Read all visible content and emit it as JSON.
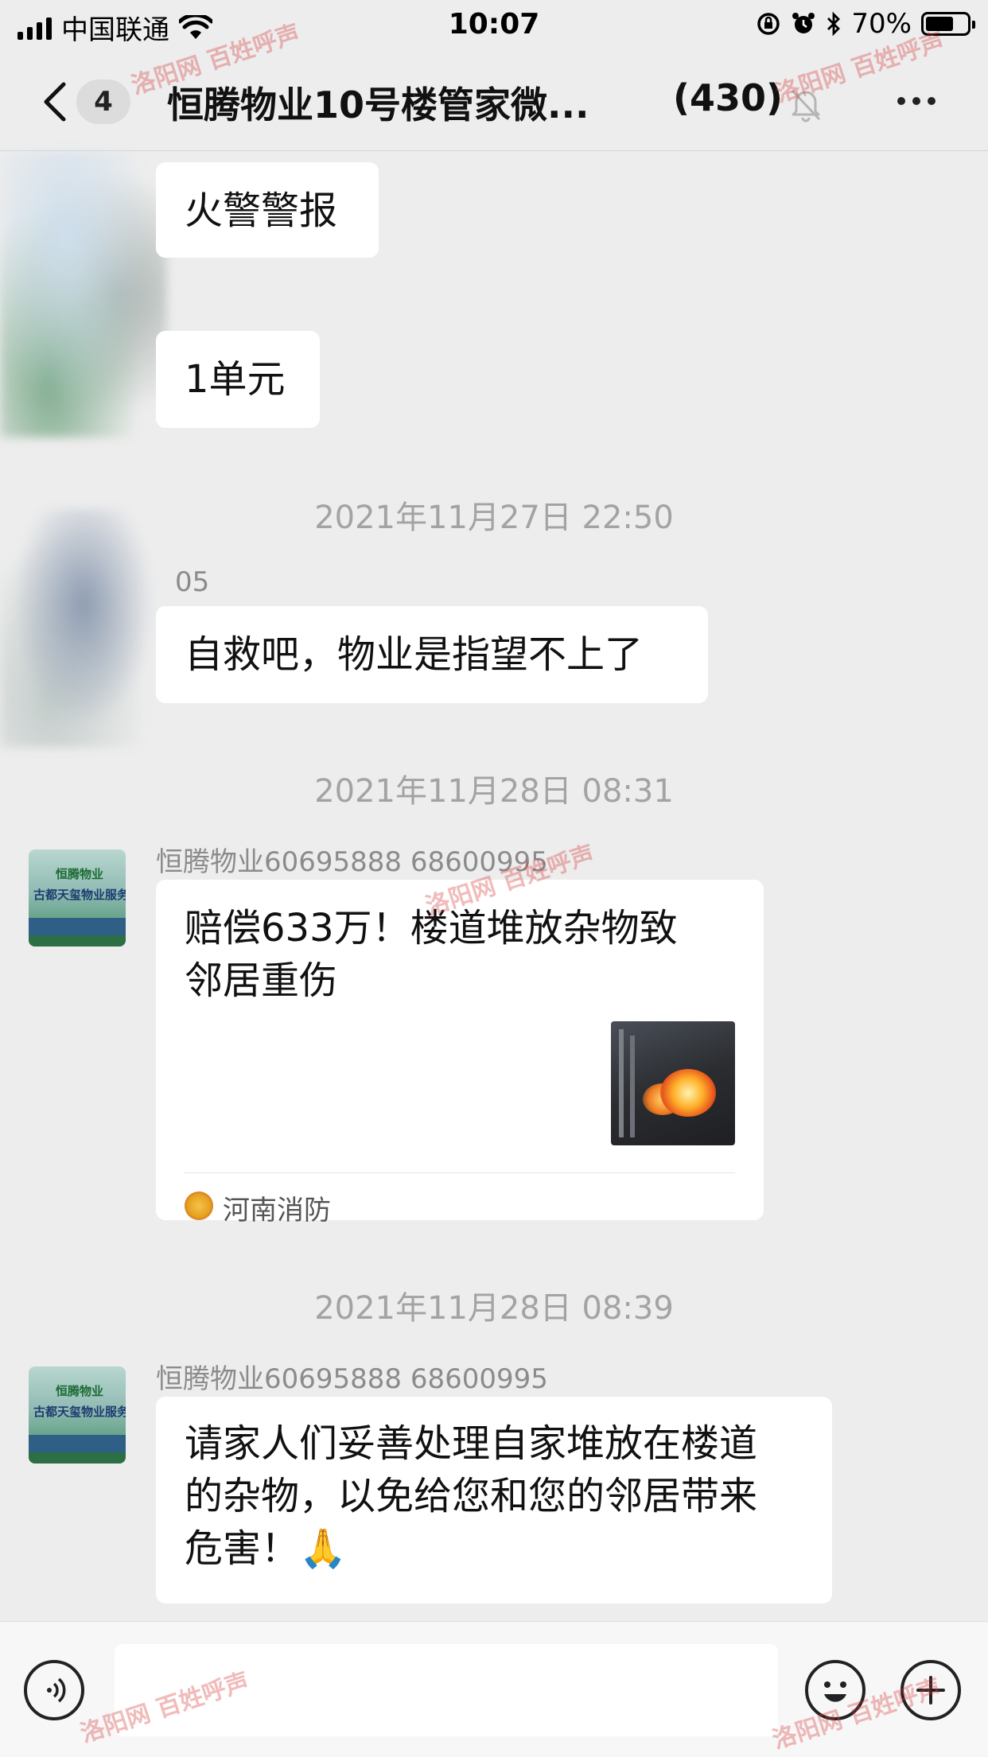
{
  "status_bar": {
    "carrier": "中国联通",
    "time": "10:07",
    "battery_pct": "70%",
    "battery_level": 0.7
  },
  "nav": {
    "unread_count": "4",
    "title": "恒腾物业10号楼管家微...",
    "member_count": "(430)",
    "icons": [
      "chevron-left-icon",
      "mute-bell-icon",
      "more-icon"
    ]
  },
  "messages": [
    {
      "type": "text",
      "text": "火警警报"
    },
    {
      "type": "text",
      "text": "1单元"
    },
    {
      "type": "timestamp",
      "text": "2021年11月27日 22:50"
    },
    {
      "type": "text",
      "sender": "05",
      "text": "自救吧，物业是指望不上了"
    },
    {
      "type": "timestamp",
      "text": "2021年11月28日 08:31"
    },
    {
      "type": "article",
      "sender": "恒腾物业60695888   68600995",
      "title_line1": "赔偿633万！楼道堆放杂物致",
      "title_line2": "邻居重伤",
      "source": "河南消防"
    },
    {
      "type": "timestamp",
      "text": "2021年11月28日 08:39"
    },
    {
      "type": "text",
      "sender": "恒腾物业60695888   68600995",
      "line1": "请家人们妥善处理自家堆放在楼道",
      "line2": "的杂物，以免给您和您的邻居带来",
      "line3": "危害！",
      "emoji": "🙏"
    }
  ],
  "avatar": {
    "logo": "恒腾物业",
    "board": "古都天玺物业服务"
  },
  "watermark": "洛阳网 百姓呼声",
  "input_bar": {
    "icons": [
      "voice-icon",
      "emoji-icon",
      "plus-icon"
    ]
  }
}
